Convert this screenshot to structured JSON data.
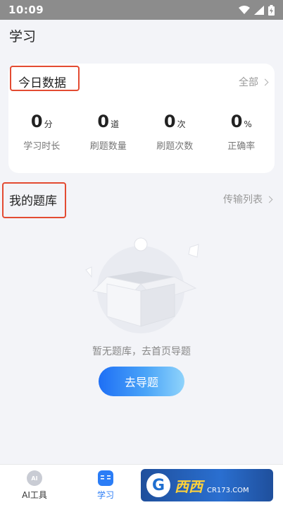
{
  "status_bar": {
    "time": "10:09"
  },
  "page": {
    "title": "学习"
  },
  "today": {
    "title": "今日数据",
    "all_label": "全部",
    "stats": [
      {
        "value": "0",
        "unit": "分",
        "label": "学习时长"
      },
      {
        "value": "0",
        "unit": "道",
        "label": "刷题数量"
      },
      {
        "value": "0",
        "unit": "次",
        "label": "刷题次数"
      },
      {
        "value": "0",
        "unit": "%",
        "label": "正确率"
      }
    ]
  },
  "my_library": {
    "title": "我的题库",
    "transfer_label": "传输列表",
    "empty_text": "暂无题库，去首页导题",
    "import_button": "去导题"
  },
  "bottom_nav": {
    "items": [
      {
        "label": "AI工具",
        "icon": "ai-icon",
        "icon_text": "AI"
      },
      {
        "label": "学习",
        "icon": "study-icon",
        "active": true
      }
    ]
  },
  "watermark": {
    "brand": "西西",
    "sub": "CR173.COM"
  },
  "colors": {
    "accent": "#2b7df6",
    "highlight_box": "#e34b32"
  }
}
